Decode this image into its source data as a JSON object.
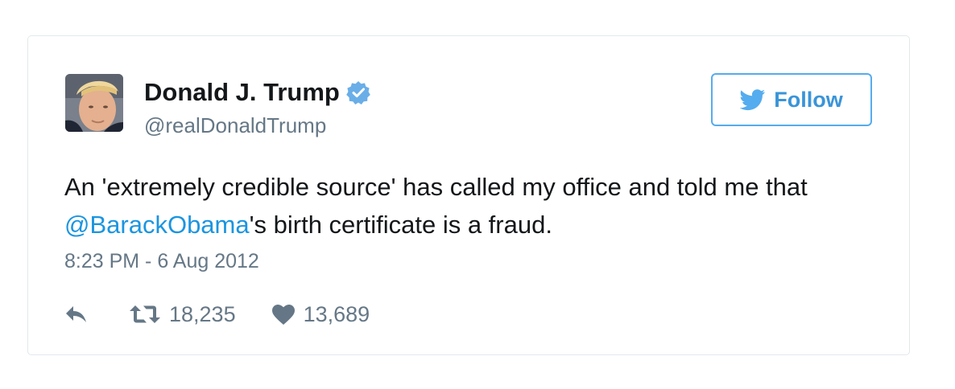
{
  "tweet": {
    "author": {
      "display_name": "Donald J. Trump",
      "handle": "@realDonaldTrump",
      "verified": true
    },
    "follow_button": {
      "label": "Follow"
    },
    "text": {
      "line1_before": "An 'extremely credible source' has called my office and told me that ",
      "mention": "@BarackObama",
      "after": "'s birth certificate is a fraud."
    },
    "timestamp": "8:23 PM - 6 Aug 2012",
    "actions": {
      "retweets": "18,235",
      "likes": "13,689"
    },
    "icons": {
      "verified": "verified-badge-icon",
      "follow": "twitter-bird-icon",
      "reply": "reply-arrow-icon",
      "retweet": "retweet-icon",
      "like": "heart-icon"
    },
    "colors": {
      "link": "#1b95e0",
      "follow_border": "#55acee",
      "muted": "#657786",
      "text": "#14171a",
      "card_border": "#e1e8ed"
    }
  }
}
